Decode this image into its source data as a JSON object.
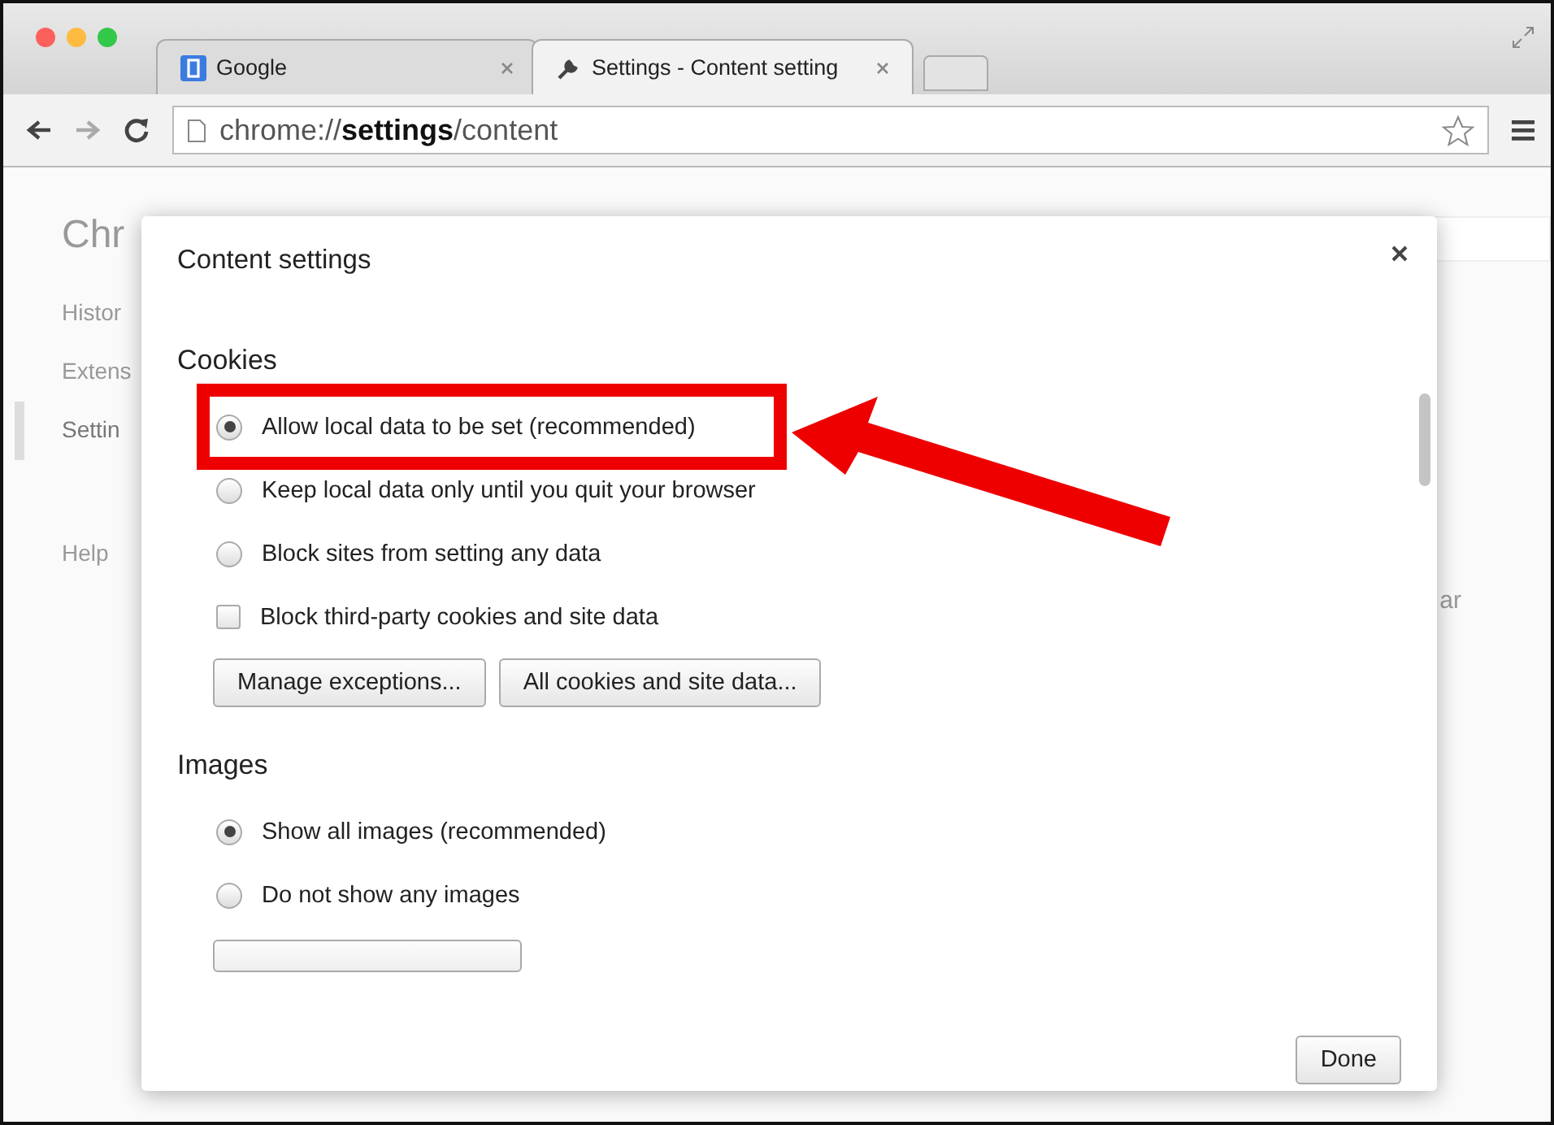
{
  "tabs": [
    {
      "label": "Google",
      "selected": false
    },
    {
      "label": "Settings - Content setting",
      "selected": true
    }
  ],
  "toolbar": {
    "url": "chrome://**settings**/content"
  },
  "sidebar": {
    "title": "Chr",
    "items": [
      {
        "label": "Histor",
        "selected": false
      },
      {
        "label": "Extens",
        "selected": false
      },
      {
        "label": "Settin",
        "selected": true
      },
      {
        "label": "Help",
        "selected": false
      }
    ]
  },
  "background_text": "ar",
  "dialog": {
    "title": "Content settings",
    "sections": [
      {
        "heading": "Cookies",
        "options": [
          {
            "kind": "radio",
            "label": "Allow local data to be set (recommended)",
            "selected": true
          },
          {
            "kind": "radio",
            "label": "Keep local data only until you quit your browser",
            "selected": false
          },
          {
            "kind": "radio",
            "label": "Block sites from setting any data",
            "selected": false
          },
          {
            "kind": "checkbox",
            "label": "Block third-party cookies and site data",
            "checked": false
          }
        ],
        "buttons": [
          "Manage exceptions...",
          "All cookies and site data..."
        ]
      },
      {
        "heading": "Images",
        "options": [
          {
            "kind": "radio",
            "label": "Show all images (recommended)",
            "selected": true
          },
          {
            "kind": "radio",
            "label": "Do not show any images",
            "selected": false
          }
        ],
        "partial_button": true
      }
    ],
    "done": "Done"
  },
  "annotation": {
    "kind": "box-and-arrow"
  }
}
